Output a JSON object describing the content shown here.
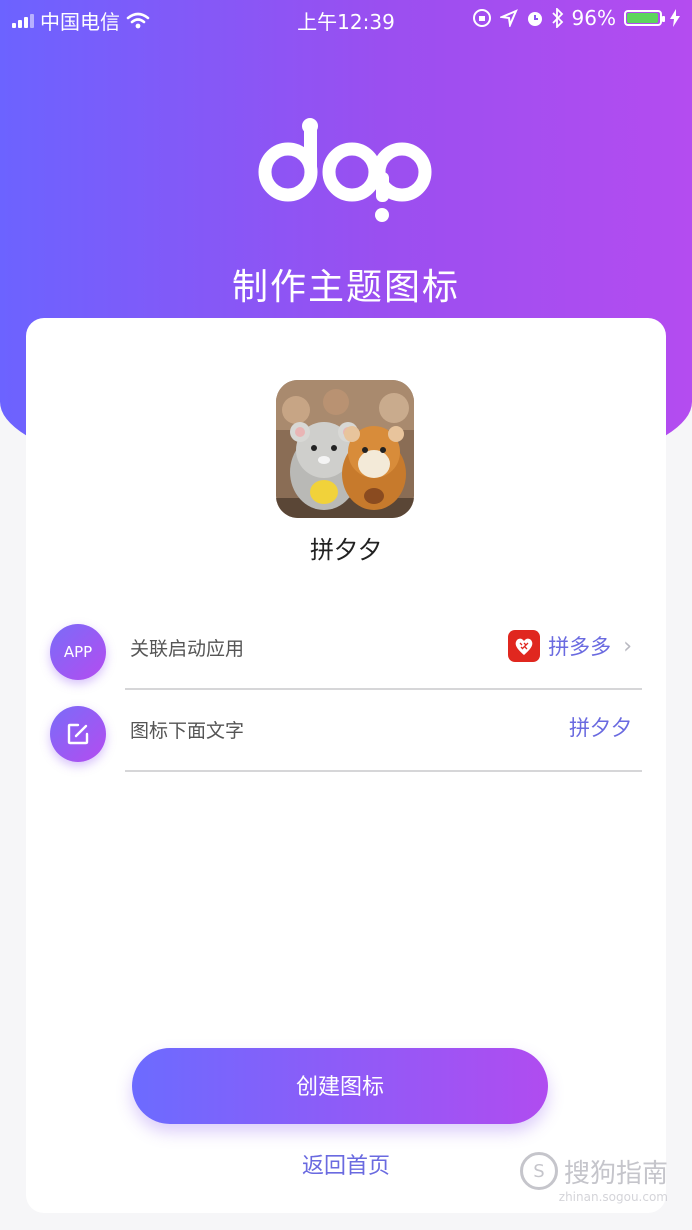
{
  "status_bar": {
    "carrier": "中国电信",
    "time": "上午12:39",
    "battery_text": "96%"
  },
  "header": {
    "title": "制作主题图标"
  },
  "icon_preview": {
    "name": "拼夕夕"
  },
  "rows": [
    {
      "badge": "APP",
      "label": "关联启动应用",
      "value": "拼多多"
    },
    {
      "badge": "edit-icon",
      "label": "图标下面文字",
      "value": "拼夕夕"
    }
  ],
  "actions": {
    "create_label": "创建图标",
    "back_label": "返回首页"
  },
  "watermark": {
    "text": "搜狗指南",
    "url": "zhinan.sogou.com"
  },
  "colors": {
    "gradient_start": "#6c63ff",
    "gradient_end": "#b44cf0",
    "accent_text": "#6a6ae0",
    "battery": "#5dd55d"
  }
}
